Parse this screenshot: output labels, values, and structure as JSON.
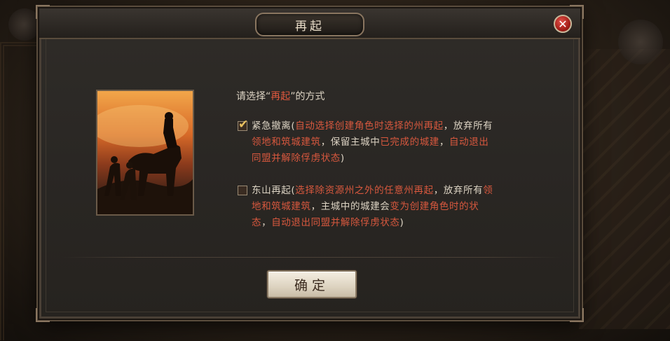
{
  "dialog": {
    "title": "再起",
    "close_icon": "close-icon"
  },
  "prompt": {
    "prefix": "请选择“",
    "highlight": "再起",
    "suffix": "”的方式"
  },
  "options": [
    {
      "checked": true,
      "name": "紧急撤离",
      "open_paren": "(",
      "detail_1": "自动选择创建角色时选择的州再起",
      "sep_1": "，放弃所有",
      "detail_2": "领地和筑城建筑",
      "sep_2": "，保留主城中",
      "detail_3": "已完成的城建",
      "sep_3": "，",
      "detail_4": "自动退出同盟并解除俘虏状态",
      "close_paren": ")"
    },
    {
      "checked": false,
      "name": "东山再起",
      "open_paren": "(",
      "detail_1": "选择除资源州之外的任意州再起",
      "sep_1": "，放弃所有",
      "detail_2": "领地和筑城建筑",
      "sep_2": "，主城中的城建会",
      "detail_3": "变为创建角色时的状态",
      "sep_3": "，",
      "detail_4": "自动退出同盟并解除俘虏状态",
      "close_paren": ")"
    }
  ],
  "confirm_button": {
    "label": "确定"
  },
  "colors": {
    "highlight_red": "#d8583e",
    "checkmark_gold": "#e8c060",
    "close_red": "#a51e18"
  }
}
